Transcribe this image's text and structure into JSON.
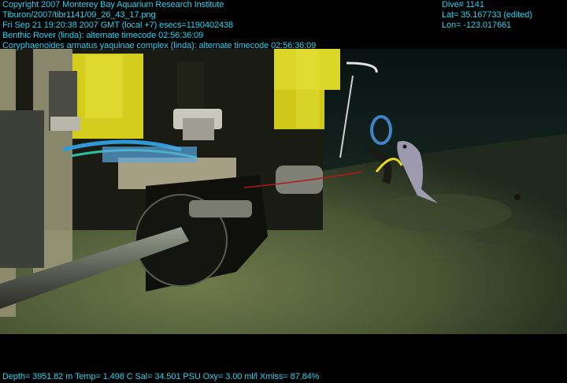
{
  "overlay": {
    "top_left": [
      "Copyright 2007 Monterey Bay Aquarium Research Institute",
      "Tiburon/2007/tibr1141/09_26_43_17.png",
      "Fri Sep 21 19:20:38 2007 GMT (local +7)  esecs=1190402438",
      "Benthic Rover (linda): alternate timecode 02:56:36:09",
      "Coryphaenoides armatus yaquinae complex (linda): alternate timecode 02:56:36:09"
    ],
    "top_right": [
      "Dive# 1141",
      "Lat= 35.167733 (edited)",
      "Lon= -123.017661"
    ],
    "bottom": "Depth= 3951.82 m  Temp= 1.498 C  Sal= 34.501 PSU  Oxy= 3.00 ml/l  Xmiss= 87.84%"
  },
  "colors": {
    "overlay_text": "#22d3f0",
    "seafloor": "#4c5a34",
    "water": "#0c1a1a",
    "float_yellow": "#d8d21c"
  }
}
